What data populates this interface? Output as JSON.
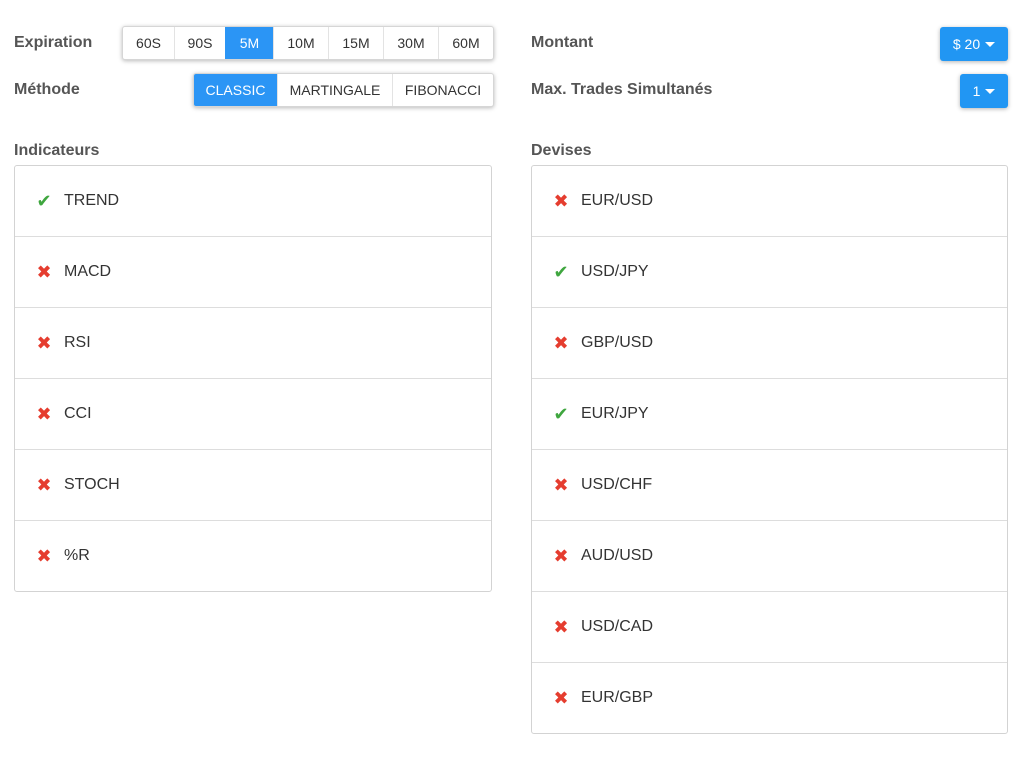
{
  "expiration": {
    "label": "Expiration",
    "options": [
      "60S",
      "90S",
      "5M",
      "10M",
      "15M",
      "30M",
      "60M"
    ],
    "selected": "5M"
  },
  "methode": {
    "label": "Méthode",
    "options": [
      "CLASSIC",
      "MARTINGALE",
      "FIBONACCI"
    ],
    "selected": "CLASSIC"
  },
  "montant": {
    "label": "Montant",
    "value": "$ 20"
  },
  "max_trades": {
    "label": "Max. Trades Simultanés",
    "value": "1"
  },
  "indicateurs": {
    "label": "Indicateurs",
    "items": [
      {
        "name": "TREND",
        "enabled": true
      },
      {
        "name": "MACD",
        "enabled": false
      },
      {
        "name": "RSI",
        "enabled": false
      },
      {
        "name": "CCI",
        "enabled": false
      },
      {
        "name": "STOCH",
        "enabled": false
      },
      {
        "name": "%R",
        "enabled": false
      }
    ]
  },
  "devises": {
    "label": "Devises",
    "items": [
      {
        "name": "EUR/USD",
        "enabled": false
      },
      {
        "name": "USD/JPY",
        "enabled": true
      },
      {
        "name": "GBP/USD",
        "enabled": false
      },
      {
        "name": "EUR/JPY",
        "enabled": true
      },
      {
        "name": "USD/CHF",
        "enabled": false
      },
      {
        "name": "AUD/USD",
        "enabled": false
      },
      {
        "name": "USD/CAD",
        "enabled": false
      },
      {
        "name": "EUR/GBP",
        "enabled": false
      }
    ]
  },
  "icons": {
    "enabled": "check-icon",
    "disabled": "cross-icon",
    "dropdown": "caret-down-icon"
  },
  "colors": {
    "accent": "#2196f3",
    "check": "#3fa63f",
    "cross": "#e53d2f"
  }
}
